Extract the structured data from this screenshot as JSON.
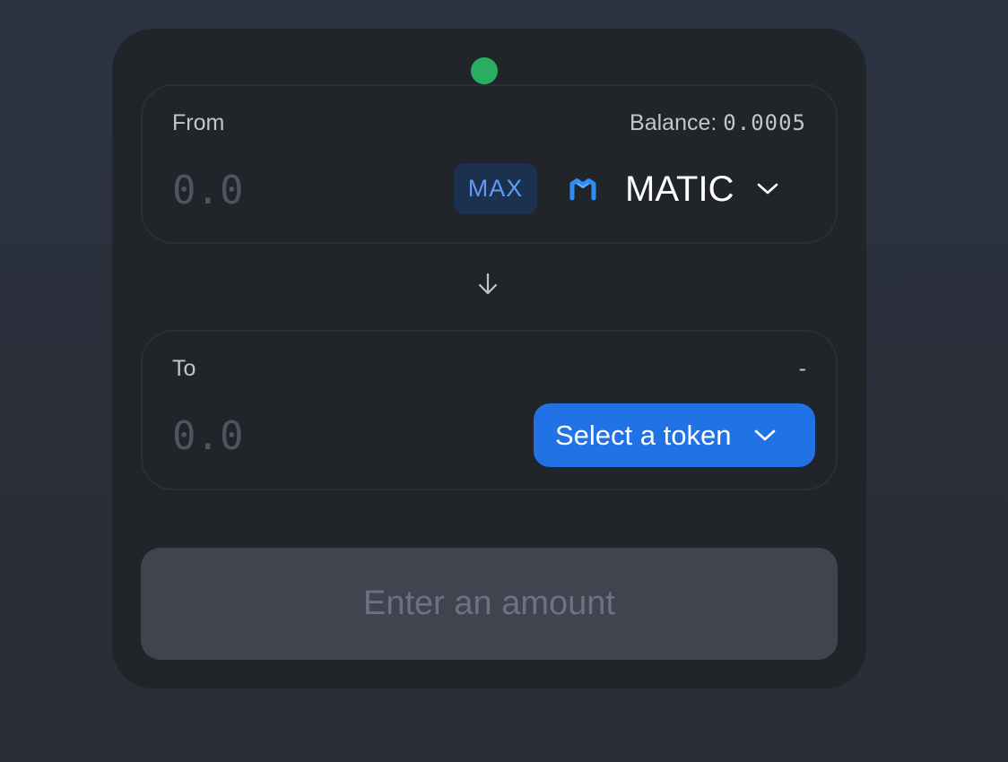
{
  "swap": {
    "from": {
      "label": "From",
      "balance_prefix": "Balance: ",
      "balance_value": "0.0005",
      "amount_placeholder": "0.0",
      "max_label": "MAX",
      "token_symbol": "MATIC",
      "token_icon": "polygon-matic-icon"
    },
    "to": {
      "label": "To",
      "balance_text": "-",
      "amount_placeholder": "0.0",
      "select_token_label": "Select a token"
    },
    "submit_label": "Enter an amount",
    "status_indicator": "connected-dot"
  },
  "colors": {
    "background": "#2b3342",
    "card": "#212429",
    "panel_border": "#2c2f36",
    "status_dot": "#27ae60",
    "max_bg": "#1c3050",
    "max_text": "#5f9cf0",
    "accent": "#2172e5",
    "matic_logo": "#2d8ef7",
    "button_disabled_bg": "#40444f",
    "button_disabled_text": "#6c7284",
    "placeholder": "#4e5461",
    "label": "#c3c5cb"
  }
}
